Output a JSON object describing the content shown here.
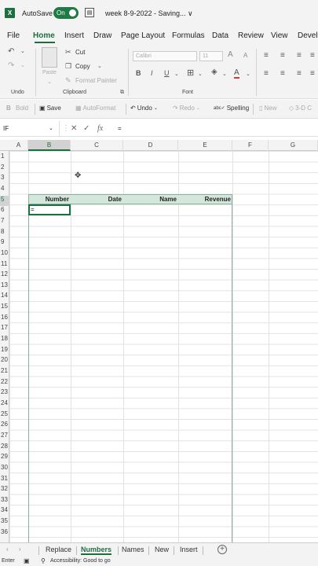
{
  "titlebar": {
    "logo": "X",
    "autosave_label": "AutoSave",
    "autosave_state": "On",
    "doc_title": "week 8-9-2022 - Saving... ∨"
  },
  "menu": {
    "tabs": [
      "File",
      "Home",
      "Insert",
      "Draw",
      "Page Layout",
      "Formulas",
      "Data",
      "Review",
      "View",
      "Develo"
    ]
  },
  "ribbon": {
    "undo_group": "Undo",
    "paste": "Paste",
    "cut": "Cut",
    "copy": "Copy",
    "format_painter": "Format Painter",
    "clipboard_group": "Clipboard",
    "font_name": "Calibri",
    "font_size": "11",
    "grow_font": "A",
    "shrink_font": "A",
    "bold": "B",
    "italic": "I",
    "underline": "U",
    "strike": "ab",
    "font_color": "A",
    "font_group": "Font"
  },
  "quick_access": {
    "bold": "Bold",
    "save": "Save",
    "autoformat": "AutoFormat",
    "undo": "Undo",
    "redo": "Redo",
    "spelling": "Spelling",
    "new": "New",
    "threed": "3-D C"
  },
  "formula_bar": {
    "name_box": "IF",
    "fx": "fx",
    "formula": "="
  },
  "grid": {
    "columns": [
      "A",
      "B",
      "C",
      "D",
      "E",
      "F",
      "G"
    ],
    "rows": [
      "1",
      "2",
      "3",
      "4",
      "5",
      "6",
      "7",
      "8",
      "9",
      "10",
      "11",
      "12",
      "13",
      "14",
      "15",
      "16",
      "17",
      "18",
      "19",
      "20",
      "21",
      "22",
      "23",
      "24",
      "25",
      "26",
      "27",
      "28",
      "29",
      "30",
      "31",
      "32",
      "33",
      "34",
      "35",
      "36"
    ],
    "table_headers": [
      "Number",
      "Date",
      "Name",
      "Revenue"
    ],
    "active_cell_value": "="
  },
  "sheets": {
    "tabs": [
      "Replace",
      "Numbers",
      "Names",
      "New",
      "Insert"
    ],
    "active": "Numbers"
  },
  "status": {
    "mode": "Enter",
    "accessibility": "Accessibility: Good to go"
  },
  "colors": {
    "accent": "#1d6f42",
    "table_header_bg": "#d4e7dd"
  }
}
